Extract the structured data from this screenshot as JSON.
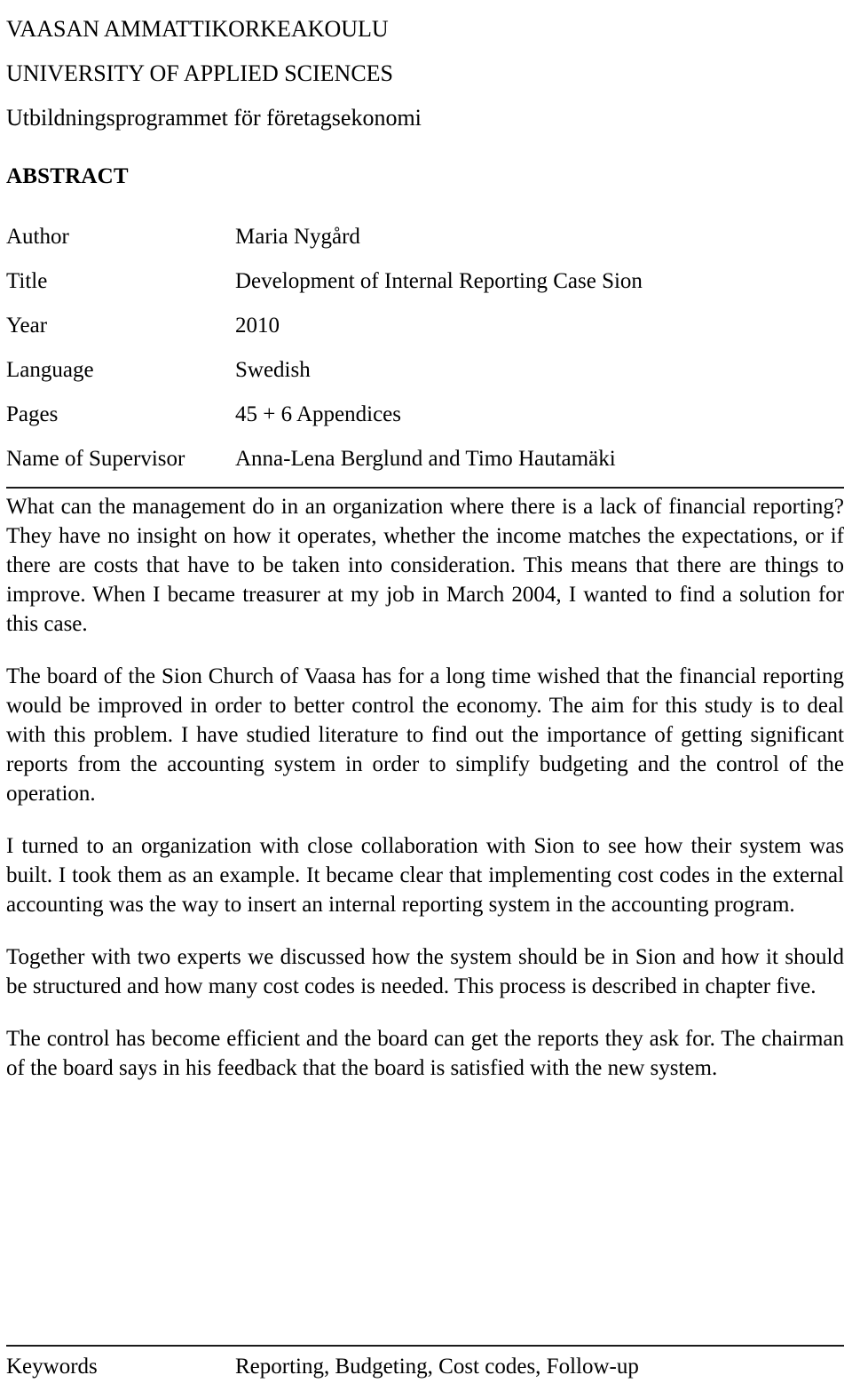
{
  "header": {
    "lines": [
      "VAASAN AMMATTIKORKEAKOULU",
      "UNIVERSITY OF APPLIED SCIENCES",
      "Utbildningsprogrammet för företagsekonomi"
    ]
  },
  "abstract_heading": "ABSTRACT",
  "metadata": {
    "rows": [
      {
        "label": "Author",
        "value": "Maria Nygård"
      },
      {
        "label": "Title",
        "value": "Development of Internal Reporting Case Sion"
      },
      {
        "label": "Year",
        "value": "2010"
      },
      {
        "label": "Language",
        "value": "Swedish"
      },
      {
        "label": "Pages",
        "value": "45 + 6 Appendices"
      },
      {
        "label": "Name of Supervisor",
        "value": "Anna-Lena Berglund and Timo Hautamäki"
      }
    ]
  },
  "abstract_body": {
    "paragraphs": [
      "What can the management do in an organization where there is a lack of financial reporting? They have no insight on how it operates, whether the income matches the expectations, or if there are costs that have to be taken into consideration. This means that there are things to improve. When I became treasurer at my job in March 2004, I wanted to find a solution for this case.",
      "The board of the Sion Church of Vaasa has for a long time wished that the financial reporting would be improved in order to better control the economy. The aim for this study is to deal with this problem. I have studied literature to find out the importance of getting significant reports from the accounting system in order to simplify budgeting and the control of the operation.",
      "I turned to an organization with close collaboration with Sion to see how their system was built. I took them as an example. It became clear that implementing cost codes in the external accounting was the way to insert an internal reporting system in the accounting program.",
      "Together with two experts we discussed how the system should be in Sion and how it should be structured and how many cost codes is needed. This process is described in chapter five.",
      "The control has become efficient and the board can get the reports they ask for. The chairman of the board says in his feedback that the board is satisfied with the new system."
    ]
  },
  "keywords": {
    "label": "Keywords",
    "value": "Reporting, Budgeting, Cost codes, Follow-up"
  },
  "colors": {
    "text": "#000000",
    "rule": "#1a1a1a",
    "background": "#ffffff"
  }
}
